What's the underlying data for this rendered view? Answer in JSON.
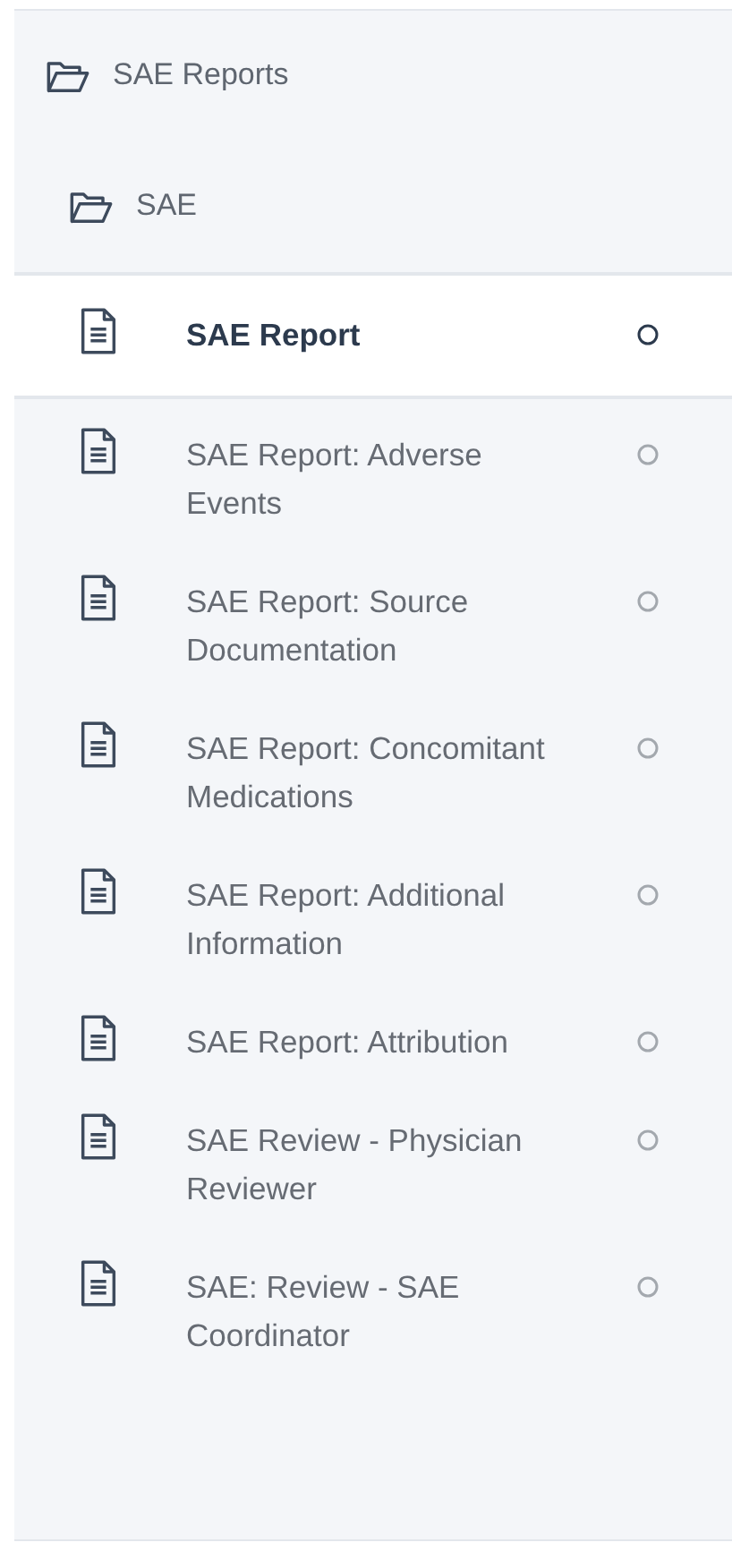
{
  "tree": {
    "label": "SAE Reports",
    "expanded": true,
    "children": [
      {
        "label": "SAE",
        "expanded": true,
        "children": [
          {
            "label": "SAE Report",
            "selected": true
          },
          {
            "label": "SAE Report: Adverse Events",
            "selected": false
          },
          {
            "label": "SAE Report: Source Documentation",
            "selected": false
          },
          {
            "label": "SAE Report: Concomitant Medications",
            "selected": false
          },
          {
            "label": "SAE Report: Additional Information",
            "selected": false
          },
          {
            "label": "SAE Report: Attribution",
            "selected": false
          },
          {
            "label": "SAE Review - Physician Reviewer",
            "selected": false
          },
          {
            "label": "SAE: Review - SAE Coordinator",
            "selected": false
          }
        ]
      }
    ]
  }
}
